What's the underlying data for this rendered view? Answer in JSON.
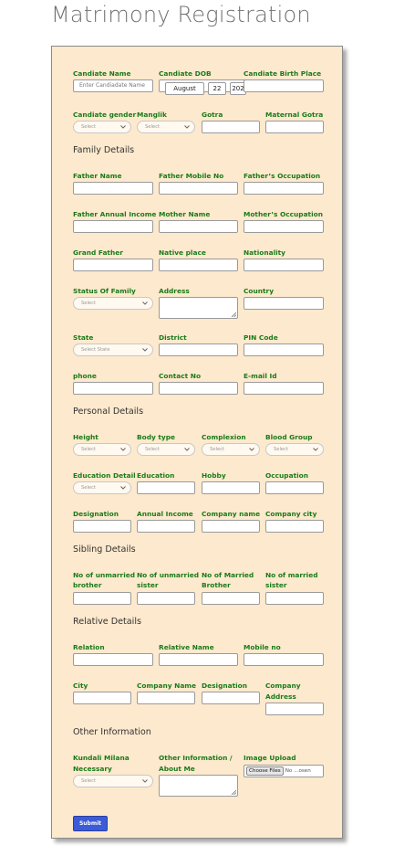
{
  "page": {
    "title": "Matrimony Registration"
  },
  "fields": {
    "candidate_name": {
      "label": "Candiate Name",
      "placeholder": "Enter Candiadate Name"
    },
    "candidate_dob": {
      "label": "Candiate DOB",
      "month": "August",
      "day": "22",
      "year": "202"
    },
    "candidate_birth_place": {
      "label": "Candiate Birth Place"
    },
    "candidate_gender": {
      "label": "Candiate gender",
      "value": "Select"
    },
    "manglik": {
      "label": "Manglik",
      "value": "Select"
    },
    "gotra": {
      "label": "Gotra"
    },
    "maternal_gotra": {
      "label": "Maternal Gotra"
    },
    "father_name": {
      "label": "Father Name"
    },
    "father_mobile": {
      "label": "Father Mobile No"
    },
    "father_occupation": {
      "label": "Father’s Occupation"
    },
    "father_income": {
      "label": "Father Annual Income"
    },
    "mother_name": {
      "label": "Mother Name"
    },
    "mother_occupation": {
      "label": "Mother’s Occupation"
    },
    "grand_father": {
      "label": "Grand Father"
    },
    "native_place": {
      "label": "Native place"
    },
    "nationality": {
      "label": "Nationality"
    },
    "family_status": {
      "label": "Status Of Family",
      "value": "Select"
    },
    "address": {
      "label": "Address"
    },
    "country": {
      "label": "Country"
    },
    "state": {
      "label": "State",
      "value": "Select State"
    },
    "district": {
      "label": "District"
    },
    "pin_code": {
      "label": "PIN Code"
    },
    "phone": {
      "label": "phone"
    },
    "contact_no": {
      "label": "Contact No"
    },
    "email": {
      "label": "E-mail Id"
    },
    "height": {
      "label": "Height",
      "value": "Select"
    },
    "body_type": {
      "label": "Body type",
      "value": "Select"
    },
    "complexion": {
      "label": "Complexion",
      "value": "Select"
    },
    "blood_group": {
      "label": "Blood Group",
      "value": "Select"
    },
    "education_detail": {
      "label": "Education Detail",
      "value": "Select"
    },
    "education": {
      "label": "Education"
    },
    "hobby": {
      "label": "Hobby"
    },
    "occupation": {
      "label": "Occupation"
    },
    "designation": {
      "label": "Designation"
    },
    "annual_income": {
      "label": "Annual Income"
    },
    "company_name": {
      "label": "Company name"
    },
    "company_city": {
      "label": "Company city"
    },
    "unmarried_brother": {
      "label1": "No of unmarried",
      "label2": "brother"
    },
    "unmarried_sister": {
      "label1": "No of unmarried",
      "label2": "sister"
    },
    "married_brother": {
      "label1": "No of Married",
      "label2": "Brother"
    },
    "married_sister": {
      "label1": "No of married",
      "label2": "sister"
    },
    "relation": {
      "label": "Relation"
    },
    "relative_name": {
      "label": "Relative Name"
    },
    "mobile_no": {
      "label": "Mobile no"
    },
    "city": {
      "label": "City"
    },
    "rel_company_name": {
      "label": "Company Name"
    },
    "rel_designation": {
      "label": "Designation"
    },
    "company_address": {
      "label1": "Company",
      "label2": "Address"
    },
    "kundali": {
      "label1": "Kundali Milana",
      "label2": "Necessary",
      "value": "Select"
    },
    "other_info": {
      "label1": "Other Information /",
      "label2": "About Me"
    },
    "image_upload": {
      "label": "Image Upload",
      "button": "Choose Files",
      "status": "No ...osen"
    }
  },
  "sections": {
    "family": "Family Details",
    "personal": "Personal Details",
    "sibling": "Sibling Details",
    "relative": "Relative Details",
    "other": "Other Information"
  },
  "submit_label": "Submit",
  "colors": {
    "card_bg": "#fde9cd",
    "label": "#1a7a1a",
    "button": "#3b5bd8"
  }
}
